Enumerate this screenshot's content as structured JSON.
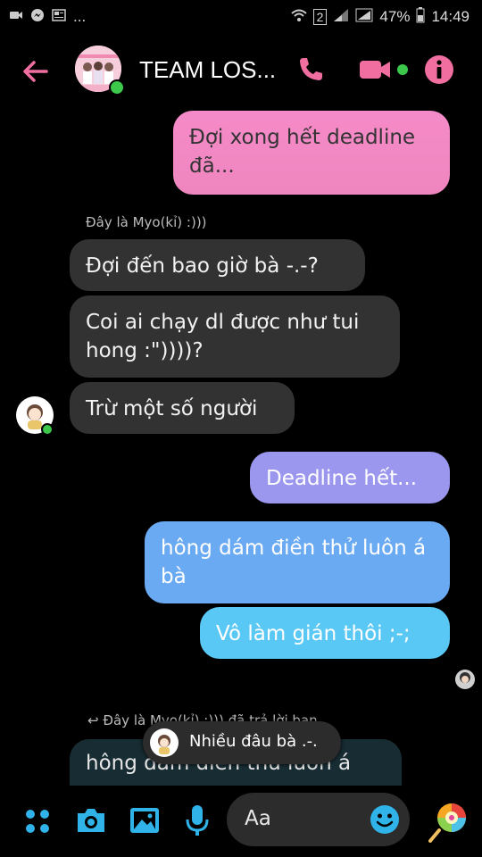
{
  "status": {
    "signal_badge": "2",
    "battery": "47%",
    "time": "14:49",
    "more": "..."
  },
  "header": {
    "title": "TEAM LOS...",
    "accent": "#f06fa0"
  },
  "messages": {
    "m1": "Đợi xong hết deadline đã...",
    "label1": "Đây là Myo(kỉ) :)))",
    "m2": "Đợi đến bao giờ bà -.-?",
    "m3": "Coi ai chạy dl được như tui hong :\"))))?",
    "m4": "Trừ một số người",
    "m5": "Deadline hết...",
    "m6": "hông dám điền thử luôn á bà",
    "m7": "Vô làm gián thôi ;-;",
    "label2": "Đây là Myo(kỉ) :))) đã trả lời bạn",
    "reply_preview": "hông dám điền thử luôn á",
    "toast": "Nhiều đâu bà .-."
  },
  "composer": {
    "placeholder": "Aa"
  },
  "colors": {
    "accent": "#f06fa0",
    "blue_accent": "#2fb3e8",
    "mine_pink": "#f28bc6",
    "mine_purple": "#9898f0",
    "mine_blue1": "#6aaaf3",
    "mine_blue2": "#5bc9f3"
  }
}
